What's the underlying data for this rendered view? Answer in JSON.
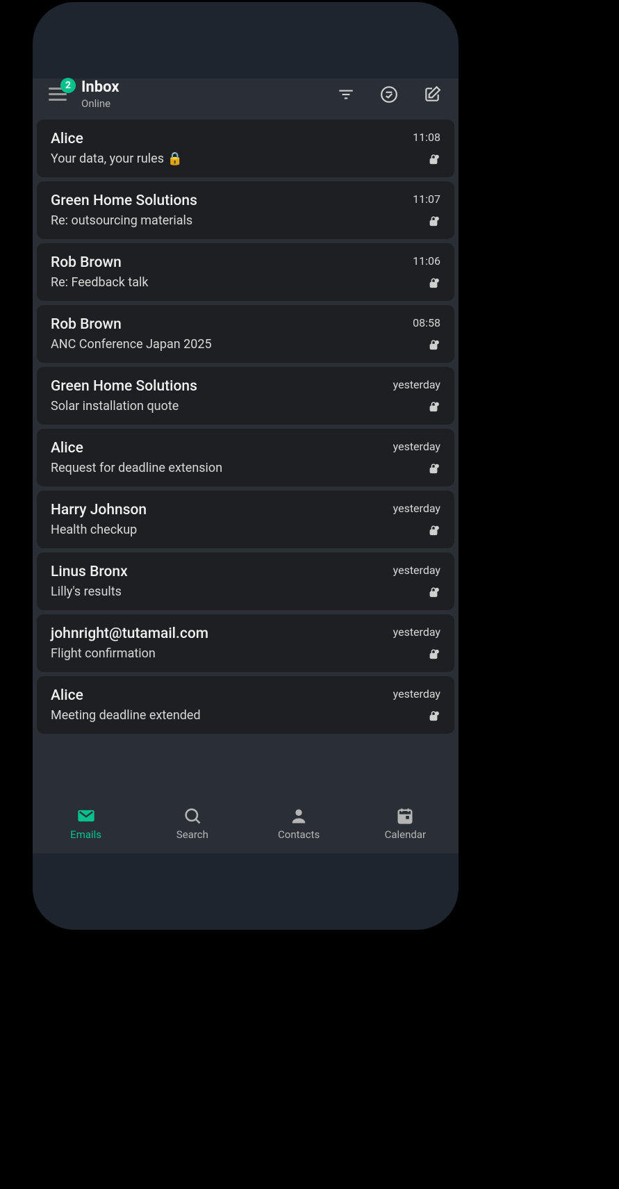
{
  "header": {
    "title": "Inbox",
    "status": "Online",
    "badge": "2"
  },
  "emails": [
    {
      "sender": "Alice",
      "subject": "Your data, your rules 🔒",
      "time": "11:08"
    },
    {
      "sender": "Green Home Solutions",
      "subject": "Re: outsourcing materials",
      "time": "11:07"
    },
    {
      "sender": "Rob Brown",
      "subject": "Re: Feedback talk",
      "time": "11:06"
    },
    {
      "sender": "Rob Brown",
      "subject": "ANC Conference Japan 2025",
      "time": "08:58"
    },
    {
      "sender": "Green Home Solutions",
      "subject": "Solar installation quote",
      "time": "yesterday"
    },
    {
      "sender": "Alice",
      "subject": "Request for deadline extension",
      "time": "yesterday"
    },
    {
      "sender": "Harry Johnson",
      "subject": "Health checkup",
      "time": "yesterday"
    },
    {
      "sender": "Linus Bronx",
      "subject": "Lilly's results",
      "time": "yesterday"
    },
    {
      "sender": "johnright@tutamail.com",
      "subject": "Flight confirmation",
      "time": "yesterday"
    },
    {
      "sender": "Alice",
      "subject": "Meeting deadline extended",
      "time": "yesterday"
    }
  ],
  "nav": {
    "emails": "Emails",
    "search": "Search",
    "contacts": "Contacts",
    "calendar": "Calendar"
  }
}
